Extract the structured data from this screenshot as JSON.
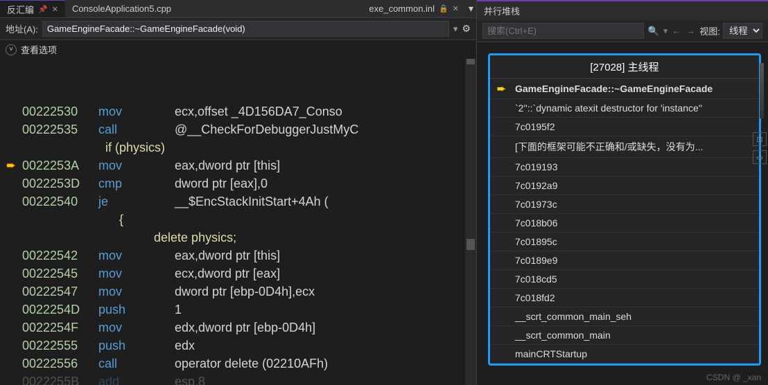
{
  "tabs": {
    "left": [
      {
        "label": "反汇编",
        "pinned": true,
        "active": true
      },
      {
        "label": "ConsoleApplication5.cpp"
      },
      {
        "label": "exe_common.inl",
        "locked": true
      }
    ]
  },
  "addressbar": {
    "label": "地址(A):",
    "value": "GameEngineFacade::~GameEngineFacade(void)"
  },
  "options_label": "查看选项",
  "disasm": [
    {
      "addr": "00222530",
      "op": "mov",
      "args": "ecx,offset _4D156DA7_Conso"
    },
    {
      "addr": "00222535",
      "op": "call",
      "args": "@__CheckForDebuggerJustMyC"
    },
    {
      "src": "    if (physics)"
    },
    {
      "addr": "0022253A",
      "op": "mov",
      "args": "eax,dword ptr [this]",
      "current": true
    },
    {
      "addr": "0022253D",
      "op": "cmp",
      "args": "dword ptr [eax],0"
    },
    {
      "addr": "00222540",
      "op": "je",
      "args": "__$EncStackInitStart+4Ah ("
    },
    {
      "src": "    {",
      "brace": true
    },
    {
      "src": "        delete physics;",
      "indent2": true
    },
    {
      "addr": "00222542",
      "op": "mov",
      "args": "eax,dword ptr [this]"
    },
    {
      "addr": "00222545",
      "op": "mov",
      "args": "ecx,dword ptr [eax]"
    },
    {
      "addr": "00222547",
      "op": "mov",
      "args": "dword ptr [ebp-0D4h],ecx"
    },
    {
      "addr": "0022254D",
      "op": "push",
      "args": "1"
    },
    {
      "addr": "0022254F",
      "op": "mov",
      "args": "edx,dword ptr [ebp-0D4h]"
    },
    {
      "addr": "00222555",
      "op": "push",
      "args": "edx"
    },
    {
      "addr": "00222556",
      "op": "call",
      "args": "operator delete (02210AFh)"
    },
    {
      "addr": "0022255B",
      "op": "add",
      "args": "esp,8",
      "faded": true
    }
  ],
  "rightpanel": {
    "title": "并行堆栈",
    "search_placeholder": "搜索(Ctrl+E)",
    "view_label": "视图:",
    "view_value": "线程",
    "thread_title": "[27028] 主线程",
    "frames": [
      {
        "label": "GameEngineFacade::~GameEngineFacade",
        "current": true
      },
      {
        "label": "`2''::`dynamic atexit destructor for 'instance''"
      },
      {
        "label": "7c0195f2"
      },
      {
        "label": "[下面的框架可能不正确和/或缺失，没有为..."
      },
      {
        "label": "7c019193"
      },
      {
        "label": "7c0192a9"
      },
      {
        "label": "7c01973c"
      },
      {
        "label": "7c018b06"
      },
      {
        "label": "7c01895c"
      },
      {
        "label": "7c0189e9"
      },
      {
        "label": "7c018cd5"
      },
      {
        "label": "7c018fd2"
      },
      {
        "label": "__scrt_common_main_seh"
      },
      {
        "label": "__scrt_common_main"
      },
      {
        "label": "mainCRTStartup"
      }
    ]
  },
  "watermark": "CSDN @ _xan"
}
